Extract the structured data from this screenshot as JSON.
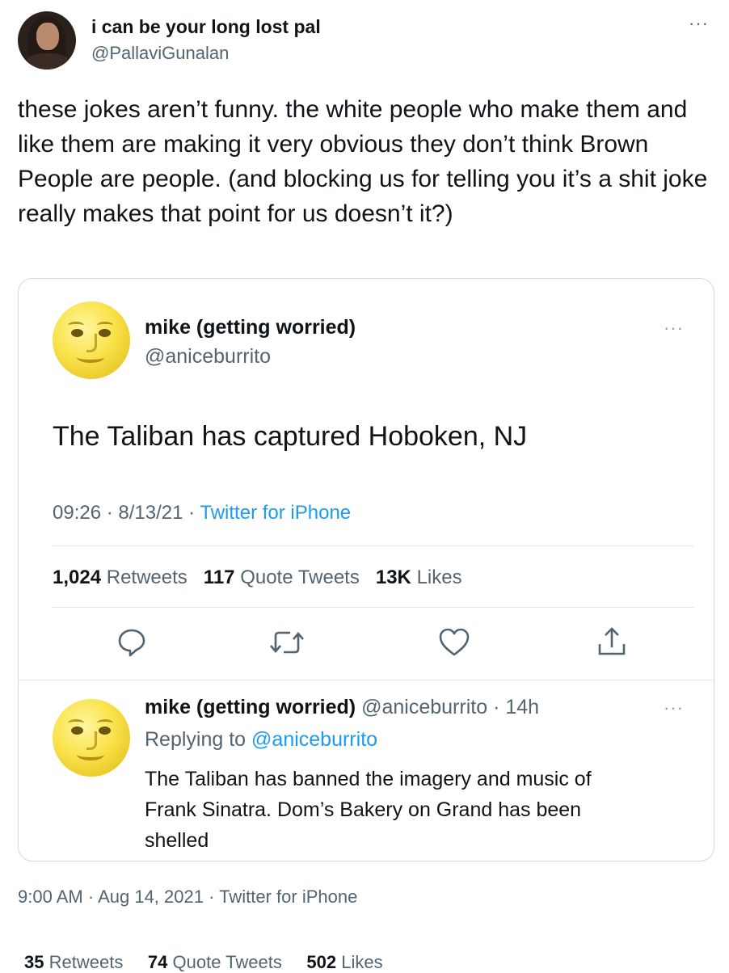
{
  "main_tweet": {
    "display_name": "i can be your long lost pal",
    "handle": "@PallaviGunalan",
    "more": "···",
    "text": "these jokes aren’t funny. the white people who make them and like them are making it very obvious they don’t think Brown People are people. (and blocking us for telling you it’s a shit joke really makes that point for us doesn’t it?)",
    "timestamp": {
      "time": "9:00 AM",
      "date": "Aug 14, 2021",
      "source": "Twitter for iPhone",
      "sep": "·"
    },
    "stats": {
      "retweets_count": "35",
      "retweets_label": "Retweets",
      "quotes_count": "74",
      "quotes_label": "Quote Tweets",
      "likes_count": "502",
      "likes_label": "Likes"
    }
  },
  "quoted_tweet": {
    "display_name": "mike (getting worried)",
    "handle": "@aniceburrito",
    "more": "···",
    "text": "The Taliban has captured Hoboken, NJ",
    "meta": {
      "time": "09:26",
      "date": "8/13/21",
      "source": "Twitter for iPhone",
      "sep": "·"
    },
    "stats": {
      "retweets_count": "1,024",
      "retweets_label": "Retweets",
      "quotes_count": "117",
      "quotes_label": "Quote Tweets",
      "likes_count": "13K",
      "likes_label": "Likes"
    },
    "actions": [
      "reply-icon",
      "retweet-icon",
      "like-icon",
      "share-icon"
    ]
  },
  "reply_tweet": {
    "display_name": "mike (getting worried)",
    "handle": "@aniceburrito",
    "age": "14h",
    "sep": "·",
    "more": "···",
    "replying_prefix": "Replying to",
    "replying_to": "@aniceburrito",
    "text_line1": "The Taliban has banned the imagery and music of",
    "text_line2": "Frank Sinatra. Dom’s Bakery on Grand has been",
    "text_line3": "shelled"
  },
  "colors": {
    "text": "#0f1419",
    "secondary": "#536471",
    "link": "#1d9bf0",
    "border": "#cfd9de"
  }
}
